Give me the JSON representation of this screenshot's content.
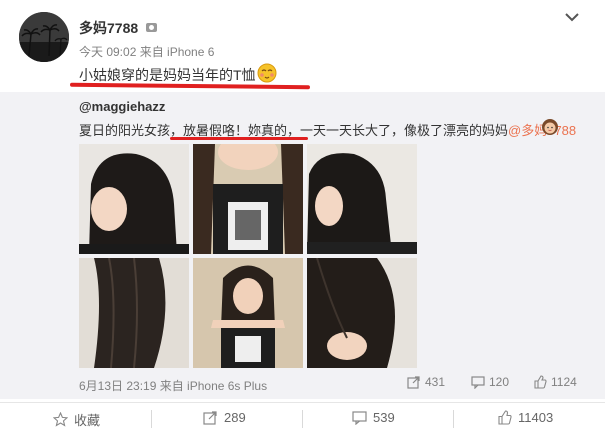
{
  "post": {
    "username": "多妈7788",
    "meta": "今天 09:02 来自 iPhone 6",
    "text": "小姑娘穿的是妈妈当年的T恤",
    "underline_color": "#e02020"
  },
  "repost": {
    "username": "@maggiehazz",
    "text_before": "夏日的阳光女孩，放暑假咯！妳真的，一天一天长大了，像极了漂亮的妈妈",
    "mention": "@多妈7788",
    "meta": "6月13日 23:19 来自 iPhone 6s Plus",
    "stats": {
      "reposts": "431",
      "comments": "120",
      "likes": "1124"
    }
  },
  "actions": {
    "favorite": "收藏",
    "repost": "289",
    "comment": "539",
    "like": "11403"
  },
  "icons": [
    "user-badge-icon",
    "chevron-down-icon",
    "blush-emoji-icon",
    "girl-emoji-icon",
    "star-icon",
    "share-icon",
    "comment-icon",
    "like-icon"
  ],
  "colors": {
    "mention": "#eb7350",
    "repost_bg": "#f2f2f5"
  }
}
